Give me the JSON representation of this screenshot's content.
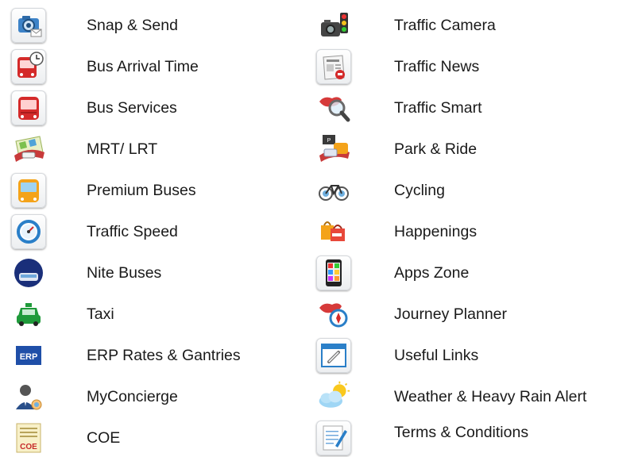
{
  "left_items": [
    {
      "label": "Snap & Send",
      "icon": "camera-mail-icon"
    },
    {
      "label": "Bus Arrival Time",
      "icon": "bus-clock-icon"
    },
    {
      "label": "Bus Services",
      "icon": "bus-icon"
    },
    {
      "label": "MRT/ LRT",
      "icon": "train-map-icon"
    },
    {
      "label": "Premium Buses",
      "icon": "premium-bus-icon"
    },
    {
      "label": "Traffic Speed",
      "icon": "speedometer-icon"
    },
    {
      "label": "Nite Buses",
      "icon": "night-bus-icon"
    },
    {
      "label": "Taxi",
      "icon": "taxi-icon"
    },
    {
      "label": "ERP Rates & Gantries",
      "icon": "erp-icon",
      "icon_text": "ERP"
    },
    {
      "label": "MyConcierge",
      "icon": "concierge-icon"
    },
    {
      "label": "COE",
      "icon": "coe-document-icon",
      "icon_text": "COE"
    }
  ],
  "right_items": [
    {
      "label": "Traffic Camera",
      "icon": "traffic-camera-icon"
    },
    {
      "label": "Traffic News",
      "icon": "newspaper-icon"
    },
    {
      "label": "Traffic Smart",
      "icon": "map-magnifier-icon"
    },
    {
      "label": "Park & Ride",
      "icon": "park-ride-icon"
    },
    {
      "label": "Cycling",
      "icon": "bicycle-icon"
    },
    {
      "label": "Happenings",
      "icon": "shopping-bags-icon"
    },
    {
      "label": "Apps Zone",
      "icon": "phone-apps-icon"
    },
    {
      "label": "Journey Planner",
      "icon": "map-compass-icon"
    },
    {
      "label": "Useful Links",
      "icon": "link-window-icon"
    },
    {
      "label": "Weather & Heavy Rain Alert",
      "icon": "weather-cloud-sun-icon"
    },
    {
      "label": "Terms & Conditions",
      "icon": "notepad-pen-icon"
    }
  ],
  "colors": {
    "bus_red": "#d42a2a",
    "taxi_green": "#1f9a3a",
    "erp_blue": "#1f4fa8",
    "premium_orange": "#f4a31a",
    "text": "#1a1a1a"
  }
}
